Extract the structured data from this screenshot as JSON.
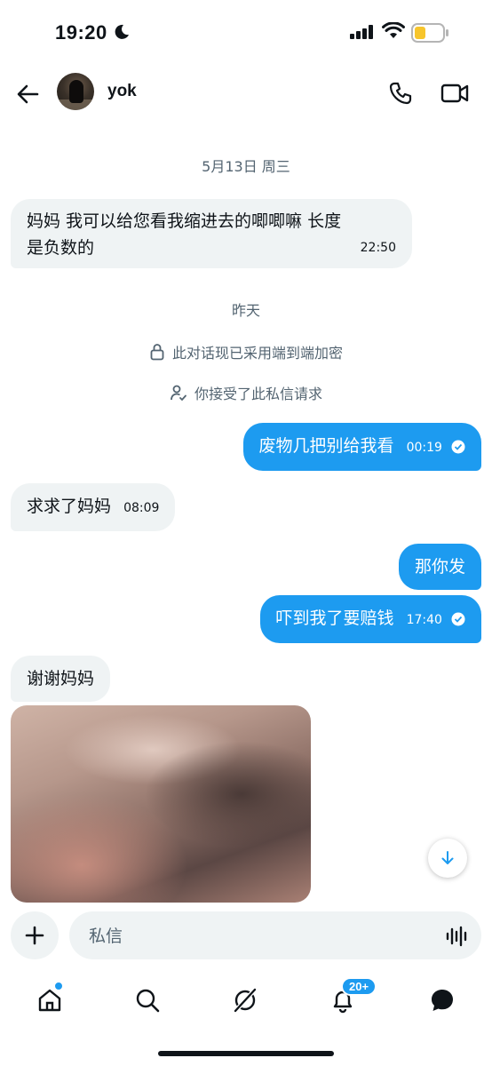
{
  "status": {
    "time": "19:20"
  },
  "header": {
    "name": "yok"
  },
  "chat": {
    "date1": "5月13日 周三",
    "msg1": {
      "text_line1": "妈妈 我可以给您看我缩进去的唧唧嘛 长度",
      "text_line2": "是负数的",
      "time": "22:50"
    },
    "date2": "昨天",
    "encryption_notice": "此对话现已采用端到端加密",
    "request_notice": "你接受了此私信请求",
    "msg2": {
      "text": "废物几把别给我看",
      "time": "00:19"
    },
    "msg3": {
      "text": "求求了妈妈",
      "time": "08:09"
    },
    "msg4": {
      "text": "那你发"
    },
    "msg5": {
      "text": "吓到我了要赔钱",
      "time": "17:40"
    },
    "msg6": {
      "text": "谢谢妈妈"
    }
  },
  "composer": {
    "placeholder": "私信"
  },
  "tabbar": {
    "notifications_badge": "20+"
  },
  "colors": {
    "accent": "#1d9bf0",
    "bubble_in": "#eff3f4",
    "text": "#0f1419",
    "muted": "#536471"
  }
}
